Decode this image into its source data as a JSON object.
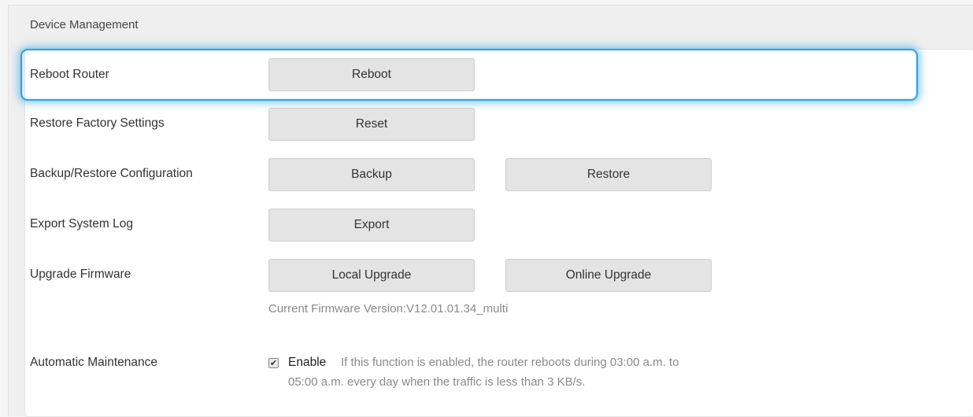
{
  "panel": {
    "title": "Device Management"
  },
  "rows": {
    "reboot": {
      "label": "Reboot Router",
      "button": "Reboot"
    },
    "reset": {
      "label": "Restore Factory Settings",
      "button": "Reset"
    },
    "backup": {
      "label": "Backup/Restore Configuration",
      "backup_button": "Backup",
      "restore_button": "Restore"
    },
    "export": {
      "label": "Export System Log",
      "button": "Export"
    },
    "upgrade": {
      "label": "Upgrade Firmware",
      "local_button": "Local Upgrade",
      "online_button": "Online Upgrade",
      "firmware_version": "Current Firmware Version:V12.01.01.34_multi"
    },
    "maintenance": {
      "label": "Automatic Maintenance",
      "checkbox_checked": true,
      "enable_label": "Enable",
      "description_line1": "If this function is enabled, the router reboots during 03:00 a.m. to",
      "description_line2": "05:00 a.m. every day when the traffic is less than 3 KB/s."
    }
  },
  "colors": {
    "highlight": "#2aa0e6",
    "button_bg": "#e4e4e4"
  },
  "icons": {
    "checkbox": "checkbox-checked-icon"
  }
}
